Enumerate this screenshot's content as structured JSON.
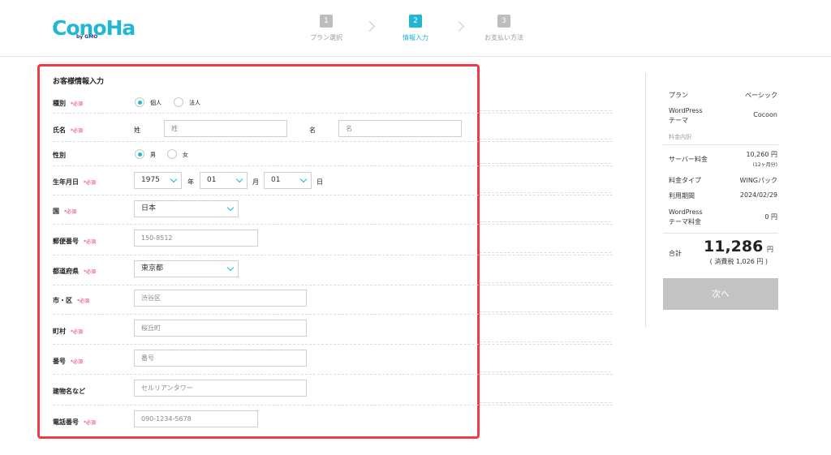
{
  "header": {
    "logo_text": "ConoHa",
    "logo_sub": "by GMO",
    "steps": [
      {
        "num": "1",
        "label": "プラン選択"
      },
      {
        "num": "2",
        "label": "情報入力"
      },
      {
        "num": "3",
        "label": "お支払い方法"
      }
    ],
    "accent_color": "#1fb7d3"
  },
  "form": {
    "title": "お客様情報入力",
    "required_mark": "*必須",
    "type": {
      "label": "種別",
      "options": [
        "個人",
        "法人"
      ],
      "selected": "個人"
    },
    "name": {
      "label": "氏名",
      "last_label": "姓",
      "last_placeholder": "姓",
      "first_label": "名",
      "first_placeholder": "名"
    },
    "gender": {
      "label": "性別",
      "options": [
        "男",
        "女"
      ],
      "selected": "男"
    },
    "birthdate": {
      "label": "生年月日",
      "year": "1975",
      "year_unit": "年",
      "month": "01",
      "month_unit": "月",
      "day": "01",
      "day_unit": "日"
    },
    "country": {
      "label": "国",
      "value": "日本"
    },
    "postal": {
      "label": "郵便番号",
      "placeholder": "150-8512"
    },
    "prefecture": {
      "label": "都道府県",
      "value": "東京都"
    },
    "city": {
      "label": "市・区",
      "placeholder": "渋谷区"
    },
    "town": {
      "label": "町村",
      "placeholder": "桜丘町"
    },
    "number": {
      "label": "番号",
      "placeholder": "番号"
    },
    "building": {
      "label": "建物名など",
      "placeholder": "セルリアンタワー"
    },
    "phone": {
      "label": "電話番号",
      "placeholder": "090-1234-5678"
    },
    "highlight_color": "#f03a45"
  },
  "summary": {
    "plan_label": "プラン",
    "plan_value": "ベーシック",
    "theme_label_1": "WordPress",
    "theme_label_2": "テーマ",
    "theme_value": "Cocoon",
    "breakdown_label": "料金内訳",
    "server_fee_label": "サーバー料金",
    "server_fee_value": "10,260 円",
    "server_fee_note": "(12ヶ月分)",
    "fee_type_label": "料金タイプ",
    "fee_type_value": "WINGパック",
    "period_label": "利用期間",
    "period_value": "2024/02/29",
    "theme_fee_label_1": "WordPress",
    "theme_fee_label_2": "テーマ料金",
    "theme_fee_value": "0 円",
    "total_label": "合計",
    "total_value": "11,286",
    "total_unit": "円",
    "tax_note": "( 消費税 1,026 円 )",
    "next_button": "次へ"
  }
}
